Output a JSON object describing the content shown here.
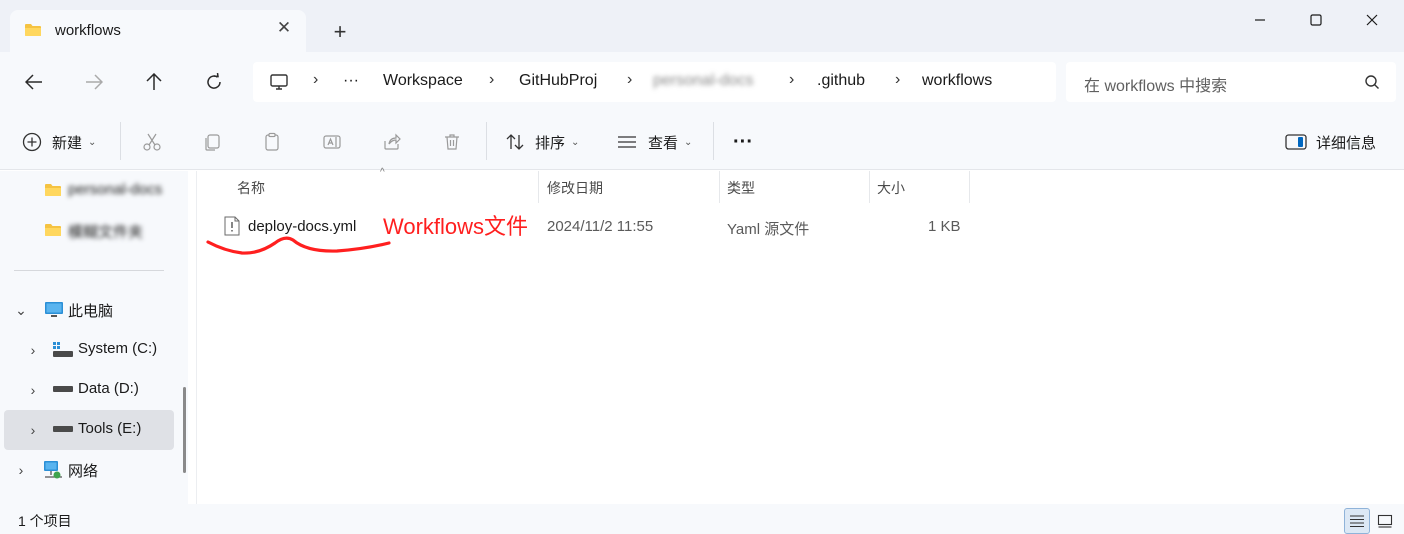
{
  "window": {
    "tab_title": "workflows",
    "new_tab": "+",
    "close_tab": "✕"
  },
  "address_bar": {
    "overflow": "···",
    "breadcrumbs": [
      "Workspace",
      "GitHubProj",
      "personal-docs",
      ".github",
      "workflows"
    ],
    "search_placeholder": "在 workflows 中搜索"
  },
  "toolbar": {
    "new_label": "新建",
    "sort_label": "排序",
    "view_label": "查看",
    "more_label": "···",
    "details_label": "详细信息"
  },
  "sidebar": {
    "pinned": [
      "personal-docs",
      "模糊文件夹"
    ],
    "this_pc": "此电脑",
    "drives": [
      {
        "label": "System (C:)"
      },
      {
        "label": "Data (D:)"
      },
      {
        "label": "Tools (E:)"
      }
    ],
    "network": "网络"
  },
  "columns": {
    "name": "名称",
    "modified": "修改日期",
    "type": "类型",
    "size": "大小"
  },
  "files": [
    {
      "name": "deploy-docs.yml",
      "modified": "2024/11/2 11:55",
      "type": "Yaml 源文件",
      "size": "1 KB"
    }
  ],
  "annotation": {
    "text": "Workflows文件",
    "color": "#ff1f1f"
  },
  "status": {
    "item_count": "1 个项目"
  },
  "colors": {
    "accent": "#0067c0",
    "folder": "#f5c342",
    "background": "#f7f9fc"
  }
}
